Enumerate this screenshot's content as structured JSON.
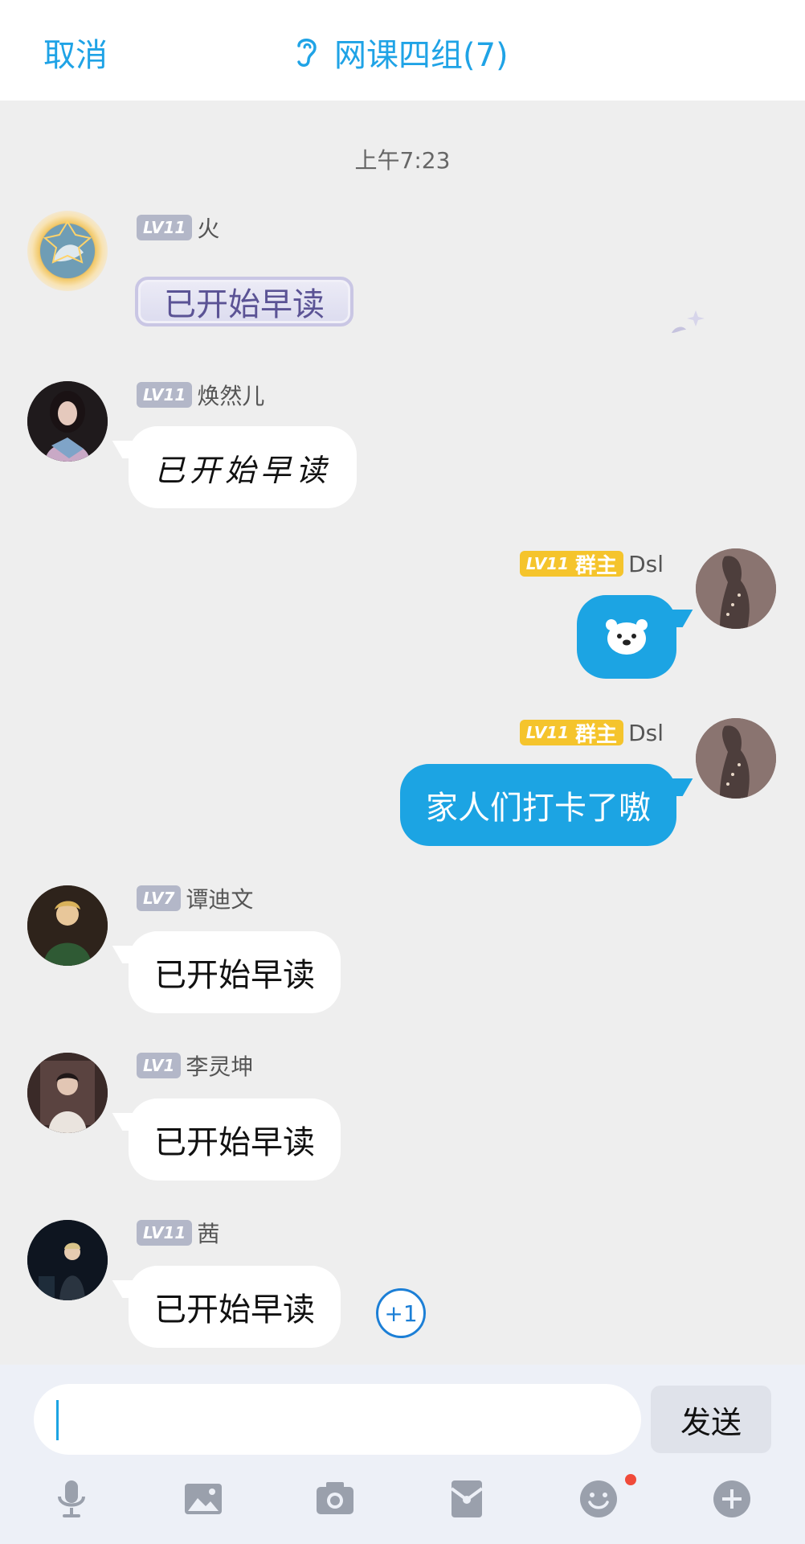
{
  "header": {
    "cancel": "取消",
    "title": "网课四组(7)"
  },
  "timestamp": "上午7:23",
  "messages": [
    {
      "level": "LV11",
      "name": "火",
      "text": "已开始早读"
    },
    {
      "level": "LV11",
      "name": "焕然儿",
      "text": "已开始早读"
    },
    {
      "level": "LV11",
      "role": "群主",
      "name": "Dsl",
      "text": ""
    },
    {
      "level": "LV11",
      "role": "群主",
      "name": "Dsl",
      "text": "家人们打卡了嗷"
    },
    {
      "level": "LV7",
      "name": "谭迪文",
      "text": "已开始早读"
    },
    {
      "level": "LV1",
      "name": "李灵坤",
      "text": "已开始早读"
    },
    {
      "level": "LV11",
      "name": "茜",
      "text": "已开始早读",
      "plus": "+1"
    }
  ],
  "input": {
    "value": "",
    "send_label": "发送"
  },
  "toolbar": [
    "mic-icon",
    "image-icon",
    "camera-icon",
    "red-packet-icon",
    "emoji-icon",
    "plus-icon"
  ],
  "colors": {
    "accent": "#1ca4e3",
    "gold": "#f5c42c",
    "badge_gray": "#b3b7c8"
  }
}
